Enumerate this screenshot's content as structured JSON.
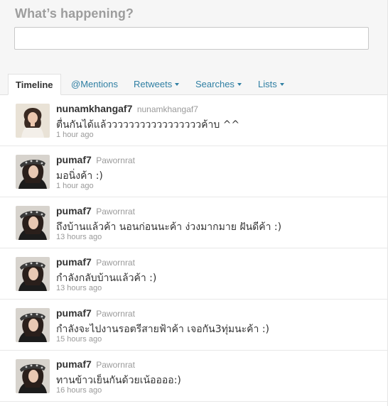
{
  "composer": {
    "title": "What’s happening?",
    "input_value": ""
  },
  "tabs": [
    {
      "label": "Timeline",
      "active": true,
      "has_menu": false
    },
    {
      "label": "@Mentions",
      "active": false,
      "has_menu": false
    },
    {
      "label": "Retweets",
      "active": false,
      "has_menu": true
    },
    {
      "label": "Searches",
      "active": false,
      "has_menu": true
    },
    {
      "label": "Lists",
      "active": false,
      "has_menu": true
    }
  ],
  "tweets": [
    {
      "username": "nunamkhangaf7",
      "fullname": "nunamkhangaf7",
      "text": "ตื่นกันได้แล้วววววววววววววววววค้าบ ^^",
      "time": "1 hour ago",
      "avatar": "avatar-nunamkhangaf7"
    },
    {
      "username": "pumaf7",
      "fullname": "Pawornrat",
      "text": "มอนิ่งค้า :)",
      "time": "1 hour ago",
      "avatar": "avatar-pumaf7"
    },
    {
      "username": "pumaf7",
      "fullname": "Pawornrat",
      "text": "ถึงบ้านแล้วค้า นอนก่อนนะค้า ง่วงมากมาย ฝันดีค้า :)",
      "time": "13 hours ago",
      "avatar": "avatar-pumaf7"
    },
    {
      "username": "pumaf7",
      "fullname": "Pawornrat",
      "text": "กำลังกลับบ้านแล้วค้า :)",
      "time": "13 hours ago",
      "avatar": "avatar-pumaf7"
    },
    {
      "username": "pumaf7",
      "fullname": "Pawornrat",
      "text": "กำลังจะไปงานรอตรีสายฟ้าค้า เจอกัน3ทุ่มนะค้า :)",
      "time": "15 hours ago",
      "avatar": "avatar-pumaf7"
    },
    {
      "username": "pumaf7",
      "fullname": "Pawornrat",
      "text": "ทานข้าวเย็นกันด้วยเน้ออออ:)",
      "time": "16 hours ago",
      "avatar": "avatar-pumaf7"
    }
  ],
  "colors": {
    "link": "#2f7fa3",
    "text": "#333333",
    "muted": "#999999",
    "panel": "#f6f6f6"
  }
}
